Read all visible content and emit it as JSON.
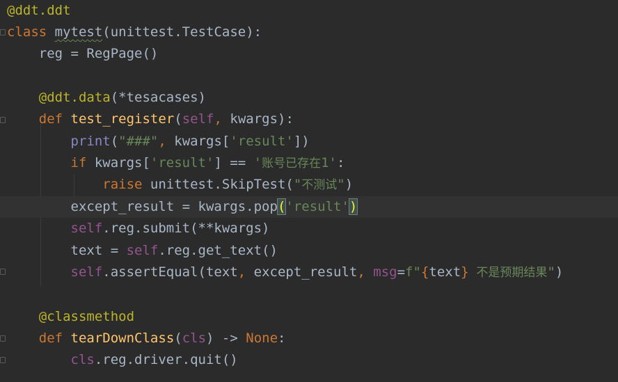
{
  "editor": {
    "language": "python",
    "colors": {
      "background": "#2b2b2b",
      "keyword": "#cc7832",
      "decorator": "#bbb529",
      "function": "#ffc66d",
      "self": "#94558d",
      "string": "#6a8759",
      "builtin": "#8888c6",
      "text": "#a9b7c6"
    },
    "lines": {
      "l1": {
        "dec": "@ddt.ddt"
      },
      "l2": {
        "kw": "class",
        "sp": " ",
        "name": "mytest",
        "rest": "(unittest.TestCase):"
      },
      "l3": {
        "indent": "    ",
        "text": "reg = RegPage()"
      },
      "l5": {
        "indent": "    ",
        "dec": "@ddt.data",
        "rest": "(*tesacases)"
      },
      "l6": {
        "indent": "    ",
        "kw": "def",
        "sp": " ",
        "fn": "test_register",
        "p1": "(",
        "self": "self",
        "comma": ",",
        "rest": " kwargs):"
      },
      "l7": {
        "indent": "        ",
        "builtin": "print",
        "p1": "(",
        "str1": "\"###\"",
        "comma": ",",
        "mid": " kwargs[",
        "str2": "'result'",
        "end": "])"
      },
      "l8": {
        "indent": "        ",
        "kw": "if",
        "mid": " kwargs[",
        "str1": "'result'",
        "mid2": "] == ",
        "str2a": "'",
        "str2cjk": "账号已存在",
        "str2b": "1'",
        "end": ":"
      },
      "l9": {
        "indent": "            ",
        "kw": "raise",
        "mid": " unittest.SkipTest(",
        "strq1": "\"",
        "strcjk": "不测试",
        "strq2": "\"",
        "end": ")"
      },
      "l10": {
        "indent": "        ",
        "mid": "except_result = kwargs.pop",
        "p1": "(",
        "str": "'result'",
        "p2": ")"
      },
      "l11": {
        "indent": "        ",
        "self": "self",
        "rest": ".reg.submit(**kwargs)"
      },
      "l12": {
        "indent": "        ",
        "mid": "text = ",
        "self": "self",
        "rest": ".reg.get_text()"
      },
      "l13": {
        "indent": "        ",
        "self": "self",
        "mid": ".assertEqual(text",
        "c1": ",",
        "mid2": " except_result",
        "c2": ",",
        "sp": " ",
        "param": "msg",
        "eq": "=",
        "fpre": "f\"",
        "brace1": "{",
        "var": "text",
        "brace2": "}",
        "strcjk": "  不是预期结果",
        "q": "\"",
        "end": ")"
      },
      "l15": {
        "indent": "    ",
        "dec": "@classmethod"
      },
      "l16": {
        "indent": "    ",
        "kw": "def",
        "sp": " ",
        "fn": "tearDownClass",
        "p1": "(",
        "self": "cls",
        "mid": ") -> ",
        "none": "None",
        "end": ":"
      },
      "l17": {
        "indent": "        ",
        "self": "cls",
        "rest": ".reg.driver.quit()"
      }
    }
  }
}
